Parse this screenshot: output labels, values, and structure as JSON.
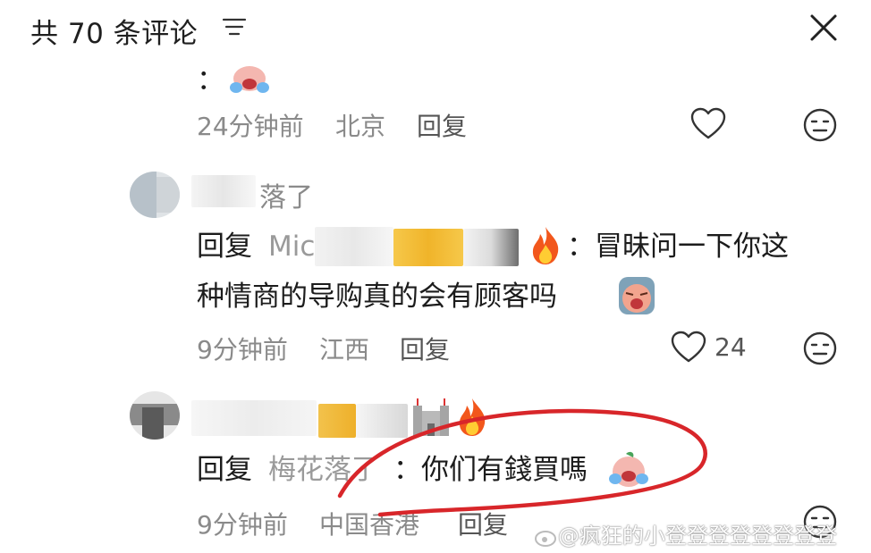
{
  "header": {
    "title": "共 70 条评论",
    "filter_icon": "filter-icon",
    "close_icon": "close-icon"
  },
  "comments": [
    {
      "tail_text": "：",
      "time": "24分钟前",
      "location": "北京",
      "reply_label": "回复",
      "like_count": ""
    },
    {
      "nickname_visible": "落了",
      "reply_prefix": "回复",
      "reply_to": "Mic",
      "text_line1": "：冒昧问一下你这",
      "text_line2": "种情商的导购真的会有顾客吗",
      "time": "9分钟前",
      "location": "江西",
      "reply_label": "回复",
      "like_count": "24"
    },
    {
      "reply_prefix": "回复",
      "reply_to": "梅花落了",
      "text": "：你们有錢買嗎",
      "time": "9分钟前",
      "location": "中国香港",
      "reply_label": "回复",
      "like_count": ""
    }
  ],
  "watermark": "@疯狂的小登登登登登登登登",
  "colors": {
    "annotation_red": "#d8262a",
    "meta_gray": "#8a8a8a"
  }
}
